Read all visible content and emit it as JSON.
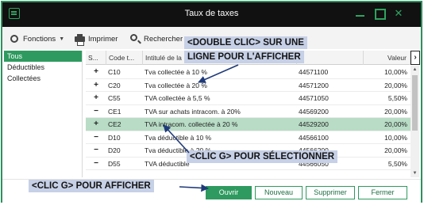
{
  "window": {
    "title": "Taux de taxes"
  },
  "toolbar": {
    "functions_label": "Fonctions",
    "print_label": "Imprimer",
    "search_label": "Rechercher"
  },
  "sidebar": {
    "items": [
      {
        "label": "Tous",
        "active": true
      },
      {
        "label": "Déductibles",
        "active": false
      },
      {
        "label": "Collectées",
        "active": false
      }
    ]
  },
  "table": {
    "headers": {
      "sign": "S...",
      "code": "Code t...",
      "label": "Intitulé de la",
      "value": "Valeur"
    },
    "rows": [
      {
        "sign": "+",
        "code": "C10",
        "label": "Tva collectée à 10 %",
        "account": "44571100",
        "value": "10,00%"
      },
      {
        "sign": "+",
        "code": "C20",
        "label": "Tva collectée à 20 %",
        "account": "44571200",
        "value": "20,00%"
      },
      {
        "sign": "+",
        "code": "C55",
        "label": "TVA collectée à 5,5 %",
        "account": "44571050",
        "value": "5,50%"
      },
      {
        "sign": "−",
        "code": "CE1",
        "label": "TVA sur achats intracom. à 20%",
        "account": "44569200",
        "value": "20,00%"
      },
      {
        "sign": "+",
        "code": "CE2",
        "label": "TVA intracom. collectée à 20 %",
        "account": "44529200",
        "value": "20,00%"
      },
      {
        "sign": "−",
        "code": "D10",
        "label": "Tva déductible à 10 %",
        "account": "44566100",
        "value": "10,00%"
      },
      {
        "sign": "−",
        "code": "D20",
        "label": "Tva déductible à 20 %",
        "account": "44566200",
        "value": "20,00%"
      },
      {
        "sign": "−",
        "code": "D55",
        "label": "TVA déductible",
        "account": "44566050",
        "value": "5,50%"
      }
    ],
    "selected_row": 4
  },
  "footer": {
    "open_label": "Ouvrir",
    "new_label": "Nouveau",
    "delete_label": "Supprimer",
    "close_label": "Fermer"
  },
  "callouts": {
    "double_click_line1": "<DOUBLE CLIC> SUR UNE",
    "double_click_line2": "LIGNE POUR L'AFFICHER",
    "click_select": "<CLIC G> POUR SÉLECTIONNER",
    "click_open": "<CLIC G> POUR AFFICHER"
  },
  "colors": {
    "accent": "#2e9a5f",
    "selection": "#b8dcc5",
    "callout_bg": "#c6d0e6",
    "arrow": "#1f3a7a"
  }
}
